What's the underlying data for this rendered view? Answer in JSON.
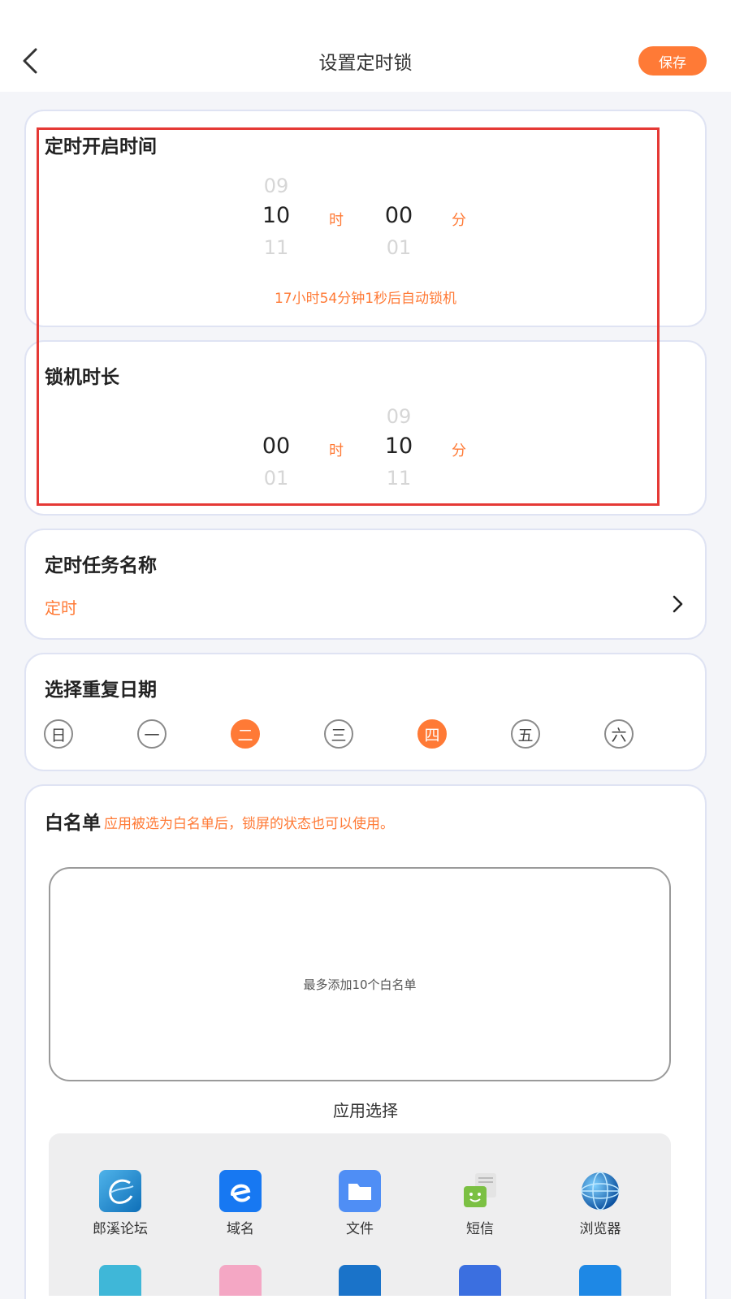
{
  "header": {
    "title": "设置定时锁",
    "save_label": "保存"
  },
  "start_time": {
    "title": "定时开启时间",
    "hour": {
      "prev": "09",
      "current": "10",
      "next": "11",
      "unit": "时"
    },
    "minute": {
      "prev": "",
      "current": "00",
      "next": "01",
      "unit": "分"
    },
    "countdown": "17小时54分钟1秒后自动锁机"
  },
  "duration": {
    "title": "锁机时长",
    "hour": {
      "prev": "",
      "current": "00",
      "next": "01",
      "unit": "时"
    },
    "minute": {
      "prev": "09",
      "current": "10",
      "next": "11",
      "unit": "分"
    }
  },
  "task_name": {
    "title": "定时任务名称",
    "value": "定时"
  },
  "repeat": {
    "title": "选择重复日期",
    "days": [
      {
        "label": "日",
        "selected": false
      },
      {
        "label": "一",
        "selected": false
      },
      {
        "label": "二",
        "selected": true
      },
      {
        "label": "三",
        "selected": false
      },
      {
        "label": "四",
        "selected": true
      },
      {
        "label": "五",
        "selected": false
      },
      {
        "label": "六",
        "selected": false
      }
    ]
  },
  "whitelist": {
    "title": "白名单",
    "hint": "应用被选为白名单后，锁屏的状态也可以使用。",
    "empty_text": "最多添加10个白名单",
    "app_select_label": "应用选择",
    "apps": [
      {
        "label": "郎溪论坛",
        "icon": "langxi-forum-icon"
      },
      {
        "label": "域名",
        "icon": "domain-icon"
      },
      {
        "label": "文件",
        "icon": "folder-icon"
      },
      {
        "label": "短信",
        "icon": "sms-icon"
      },
      {
        "label": "浏览器",
        "icon": "globe-icon"
      }
    ]
  },
  "colors": {
    "accent": "#ff7a36",
    "card_border": "#dfe3f3",
    "highlight_frame": "#e53935"
  }
}
